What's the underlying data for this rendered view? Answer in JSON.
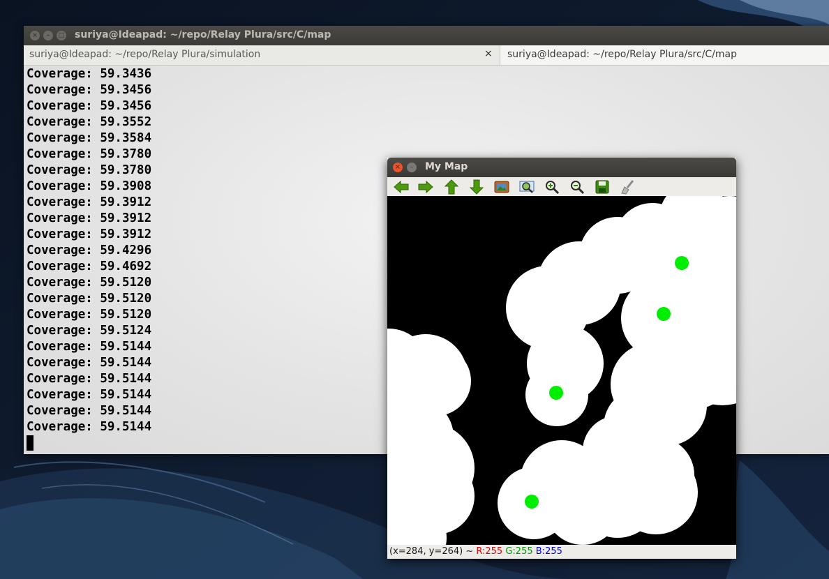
{
  "terminal": {
    "title": "suriya@Ideapad: ~/repo/Relay Plura/src/C/map",
    "tabs": [
      {
        "label": "suriya@Ideapad: ~/repo/Relay Plura/simulation"
      },
      {
        "label": "suriya@Ideapad: ~/repo/Relay Plura/src/C/map"
      }
    ],
    "tab_close_glyph": "×",
    "lines": [
      "Coverage: 59.3436",
      "Coverage: 59.3456",
      "Coverage: 59.3456",
      "Coverage: 59.3552",
      "Coverage: 59.3584",
      "Coverage: 59.3780",
      "Coverage: 59.3780",
      "Coverage: 59.3908",
      "Coverage: 59.3912",
      "Coverage: 59.3912",
      "Coverage: 59.3912",
      "Coverage: 59.4296",
      "Coverage: 59.4692",
      "Coverage: 59.5120",
      "Coverage: 59.5120",
      "Coverage: 59.5120",
      "Coverage: 59.5124",
      "Coverage: 59.5144",
      "Coverage: 59.5144",
      "Coverage: 59.5144",
      "Coverage: 59.5144",
      "Coverage: 59.5144",
      "Coverage: 59.5144"
    ]
  },
  "map_window": {
    "title": "My Map",
    "toolbar_icons": [
      "arrow-left-icon",
      "arrow-right-icon",
      "arrow-up-icon",
      "arrow-down-icon",
      "image-icon",
      "zoom-fit-icon",
      "zoom-in-icon",
      "zoom-out-icon",
      "save-icon",
      "brush-icon"
    ],
    "status": {
      "coords": "(x=284, y=264) ~ ",
      "r": "R:255",
      "g": "G:255",
      "b": "B:255",
      "colors": {
        "r": "#e00000",
        "g": "#009900",
        "b": "#0000dd"
      }
    },
    "colors": {
      "coverage": "#ffffff",
      "background": "#000000",
      "node": "#00ee00"
    }
  }
}
